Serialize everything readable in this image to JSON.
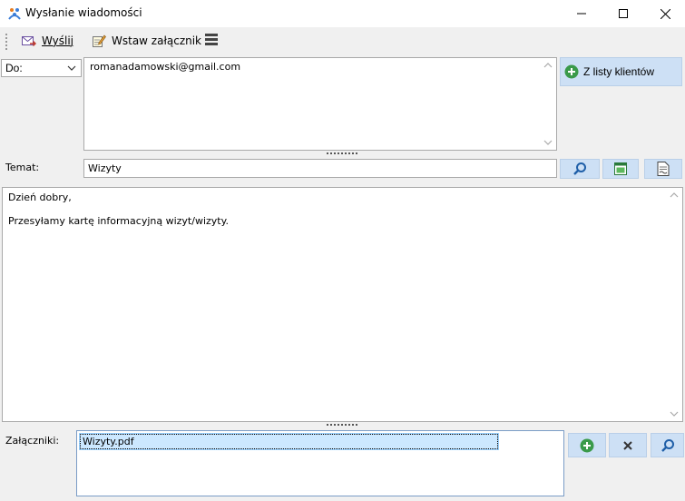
{
  "window": {
    "title": "Wysłanie wiadomości"
  },
  "toolbar": {
    "send_label": "Wyślij",
    "attach_label": "Wstaw załącznik"
  },
  "recipient": {
    "field_select": "Do:",
    "to_value": "romanadamowski@gmail.com",
    "from_clients_label": "Z listy klientów"
  },
  "subject": {
    "label": "Temat:",
    "value": "Wizyty"
  },
  "body": {
    "line1": "Dzień dobry,",
    "line2": "Przesyłamy kartę informacyjną wizyt/wizyty."
  },
  "attachments": {
    "label": "Załączniki:",
    "items": [
      "Wizyty.pdf"
    ]
  },
  "colors": {
    "button_bg": "#cde0f5",
    "add_green": "#3a9a4a",
    "icon_blue": "#2a6db5"
  }
}
